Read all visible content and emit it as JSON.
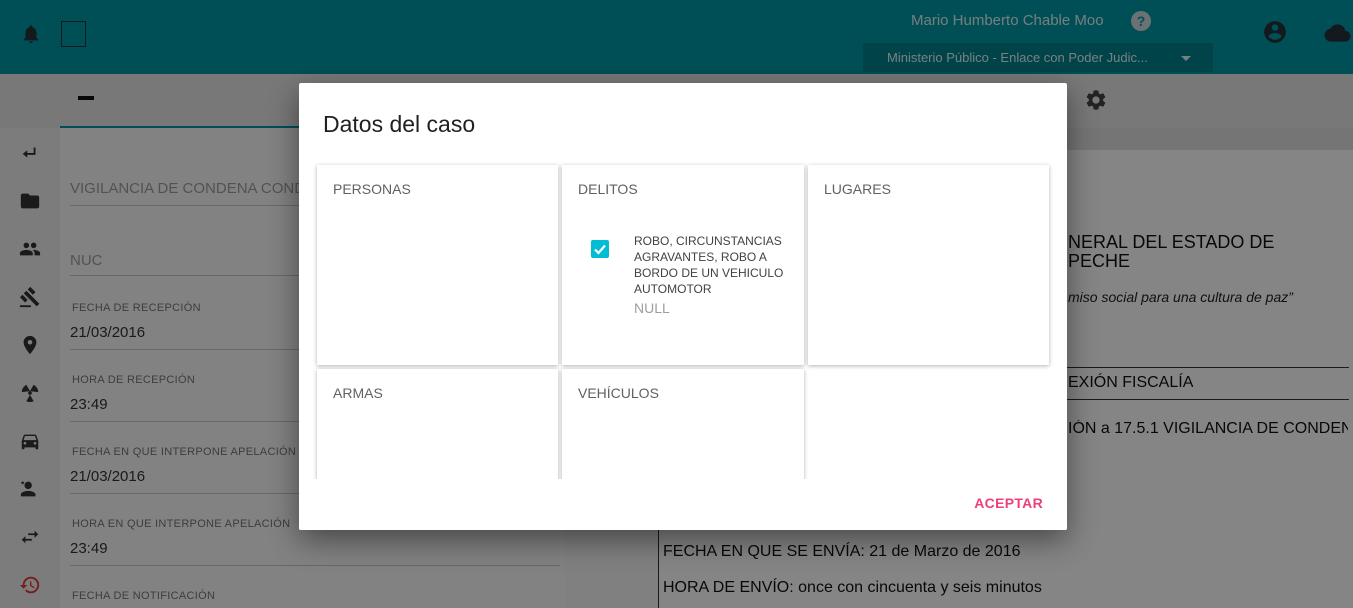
{
  "header": {
    "user_name": "Mario Humberto Chable Moo",
    "help_symbol": "?",
    "role_selected": "Ministerio Público - Enlace con Poder Judic..."
  },
  "sidebar": {
    "icons": [
      "back-arrow-icon",
      "folder-icon",
      "people-icon",
      "gavel-icon",
      "location-pin-icon",
      "radioactive-icon",
      "car-icon",
      "person-star-icon",
      "swap-arrows-icon",
      "history-icon"
    ]
  },
  "form": {
    "case_type": "VIGILANCIA DE CONDENA CONDI",
    "nuc_label": "NUC",
    "fields": [
      {
        "label": "FECHA DE RECEPCIÓN",
        "value": "21/03/2016"
      },
      {
        "label": "HORA DE RECEPCIÓN",
        "value": "23:49"
      },
      {
        "label": "FECHA EN QUE INTERPONE APELACIÓN",
        "value": "21/03/2016"
      },
      {
        "label": "HORA EN QUE INTERPONE APELACIÓN",
        "value": "23:49"
      },
      {
        "label": "FECHA DE NOTIFICACIÓN",
        "value": ""
      }
    ]
  },
  "document": {
    "title_line1": "NERAL DEL ESTADO DE",
    "title_line2": "PECHE",
    "motto": "miso social para una cultura de paz”",
    "row1": "EXIÓN FISCALÍA",
    "row2": "IÓN a 17.5.1 VIGILANCIA DE CONDENA",
    "sent_date": "FECHA EN QUE SE ENVÍA: 21 de Marzo de 2016",
    "sent_time": "HORA DE ENVÍO: once con cincuenta y seis minutos"
  },
  "dialog": {
    "title": "Datos del caso",
    "cards": {
      "personas": "PERSONAS",
      "delitos": "DELITOS",
      "lugares": "LUGARES",
      "armas": "ARMAS",
      "vehiculos": "VEHÍCULOS"
    },
    "crime": {
      "checked": true,
      "name": "ROBO, CIRCUNSTANCIAS AGRAVANTES, ROBO A BORDO DE UN VEHICULO AUTOMOTOR",
      "detail": "NULL"
    },
    "accept_label": "ACEPTAR"
  },
  "colors": {
    "primary": "#0097a7",
    "accent": "#ec407a",
    "checkbox": "#00bcd4"
  }
}
